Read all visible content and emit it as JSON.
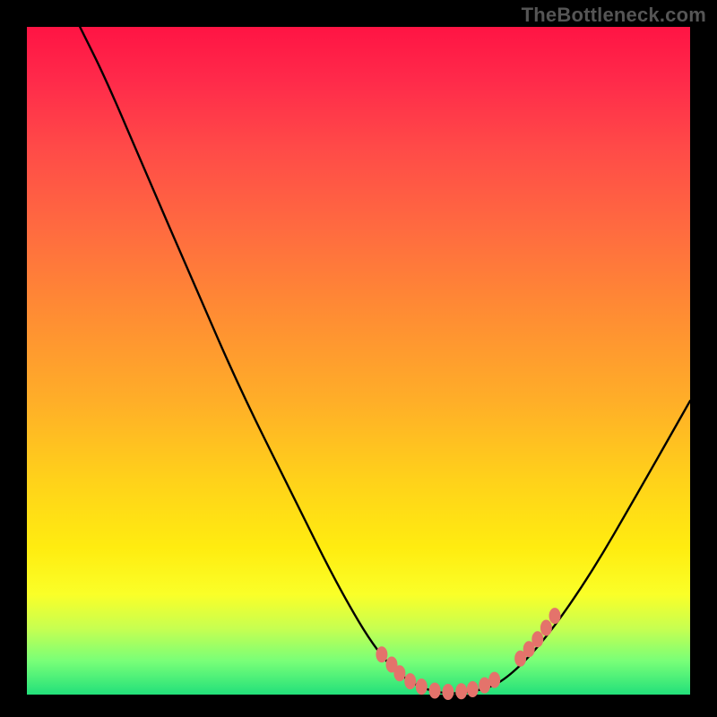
{
  "watermark": "TheBottleneck.com",
  "chart_data": {
    "type": "line",
    "title": "",
    "xlabel": "",
    "ylabel": "",
    "series": [
      {
        "name": "curve",
        "points": [
          {
            "x": 0.08,
            "y": 1.0
          },
          {
            "x": 0.12,
            "y": 0.92
          },
          {
            "x": 0.18,
            "y": 0.78
          },
          {
            "x": 0.25,
            "y": 0.62
          },
          {
            "x": 0.32,
            "y": 0.46
          },
          {
            "x": 0.4,
            "y": 0.3
          },
          {
            "x": 0.47,
            "y": 0.16
          },
          {
            "x": 0.53,
            "y": 0.06
          },
          {
            "x": 0.58,
            "y": 0.015
          },
          {
            "x": 0.63,
            "y": 0.0
          },
          {
            "x": 0.68,
            "y": 0.005
          },
          {
            "x": 0.72,
            "y": 0.02
          },
          {
            "x": 0.78,
            "y": 0.08
          },
          {
            "x": 0.85,
            "y": 0.18
          },
          {
            "x": 0.92,
            "y": 0.3
          },
          {
            "x": 1.0,
            "y": 0.44
          }
        ]
      },
      {
        "name": "highlight-dots",
        "points": [
          {
            "x": 0.535,
            "y": 0.06
          },
          {
            "x": 0.55,
            "y": 0.045
          },
          {
            "x": 0.562,
            "y": 0.032
          },
          {
            "x": 0.578,
            "y": 0.02
          },
          {
            "x": 0.595,
            "y": 0.012
          },
          {
            "x": 0.615,
            "y": 0.006
          },
          {
            "x": 0.635,
            "y": 0.004
          },
          {
            "x": 0.655,
            "y": 0.005
          },
          {
            "x": 0.672,
            "y": 0.008
          },
          {
            "x": 0.69,
            "y": 0.014
          },
          {
            "x": 0.705,
            "y": 0.022
          },
          {
            "x": 0.744,
            "y": 0.054
          },
          {
            "x": 0.757,
            "y": 0.068
          },
          {
            "x": 0.77,
            "y": 0.083
          },
          {
            "x": 0.783,
            "y": 0.1
          },
          {
            "x": 0.796,
            "y": 0.118
          }
        ]
      }
    ],
    "xlim": [
      0,
      1
    ],
    "ylim": [
      0,
      1
    ],
    "colors": {
      "curve": "#000000",
      "dots": "#e4736b",
      "background_top": "#ff1444",
      "background_bottom": "#22e07a"
    }
  }
}
